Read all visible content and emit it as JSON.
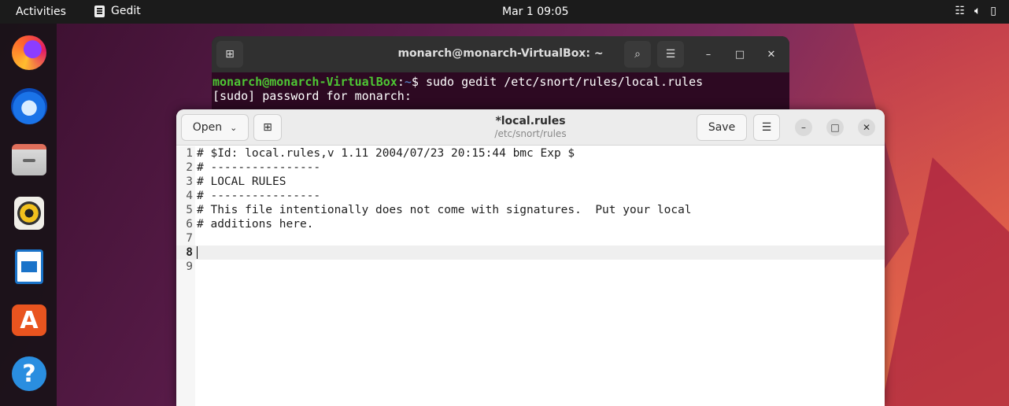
{
  "topbar": {
    "activities": "Activities",
    "app_name": "Gedit",
    "clock": "Mar 1  09:05",
    "tray": [
      "network-icon",
      "volume-icon",
      "battery-icon"
    ]
  },
  "dock": {
    "items": [
      "firefox",
      "thunderbird",
      "files",
      "rhythmbox",
      "libreoffice-writer",
      "app-center",
      "help"
    ],
    "app_center_glyph": "A",
    "help_glyph": "?"
  },
  "terminal": {
    "title": "monarch@monarch-VirtualBox: ~",
    "prompt_user": "monarch@monarch-VirtualBox",
    "prompt_sep": ":",
    "prompt_path": "~",
    "prompt_dollar": "$ ",
    "command": "sudo gedit /etc/snort/rules/local.rules",
    "output_line": "[sudo] password for monarch:"
  },
  "gedit": {
    "open_label": "Open",
    "save_label": "Save",
    "title": "*local.rules",
    "subtitle": "/etc/snort/rules",
    "lines": [
      "# $Id: local.rules,v 1.11 2004/07/23 20:15:44 bmc Exp $",
      "# ----------------",
      "# LOCAL RULES",
      "# ----------------",
      "# This file intentionally does not come with signatures.  Put your local",
      "# additions here.",
      "",
      "",
      ""
    ],
    "line_numbers": [
      "1",
      "2",
      "3",
      "4",
      "5",
      "6",
      "7",
      "8",
      "9"
    ],
    "current_line": 8
  }
}
